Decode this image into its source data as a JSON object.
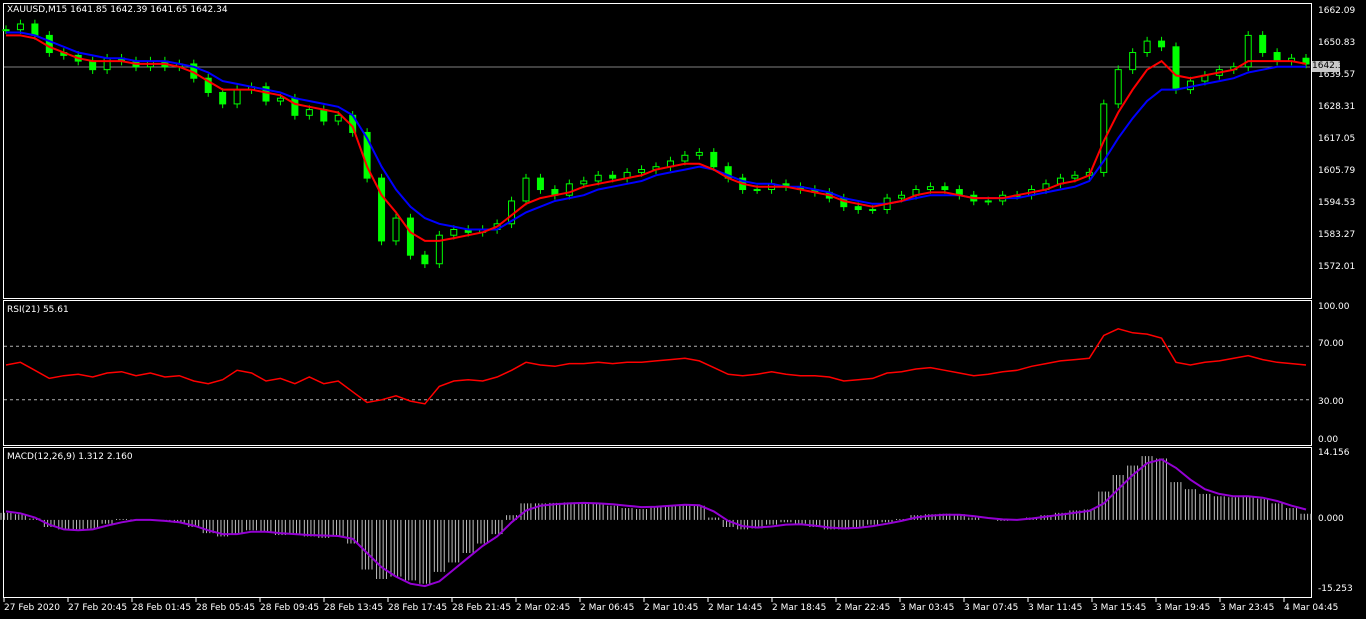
{
  "header": {
    "symbol": "XAUUSD,M15",
    "open": "1641.85",
    "high": "1642.39",
    "low": "1641.65",
    "close": "1642.34"
  },
  "current_price_label": "1642.34",
  "colors": {
    "background": "#000000",
    "frame": "#ffffff",
    "candle": "#00ff00",
    "ma_fast": "#ff0000",
    "ma_slow": "#0000ff",
    "rsi": "#ff0000",
    "macd_hist": "#c0c0c0",
    "macd_signal": "#9400d3"
  },
  "rsi": {
    "title": "RSI(21) 55.61",
    "levels": [
      70,
      30
    ],
    "ticks": [
      "100.00",
      "70.00",
      "30.00",
      "0.00"
    ]
  },
  "macd": {
    "title": "MACD(12,26,9) 1.312 2.160",
    "ticks": [
      "14.156",
      "0.000",
      "-15.253"
    ]
  },
  "chart_data": [
    {
      "type": "candlestick",
      "title": "XAUUSD,M15",
      "ylim": [
        1560,
        1663
      ],
      "yticks": [
        "1662.09",
        "1650.83",
        "1639.57",
        "1628.31",
        "1617.05",
        "1605.79",
        "1594.53",
        "1583.27",
        "1572.01"
      ],
      "x_labels": [
        "27 Feb 2020",
        "27 Feb 20:45",
        "28 Feb 01:45",
        "28 Feb 05:45",
        "28 Feb 09:45",
        "28 Feb 13:45",
        "28 Feb 17:45",
        "28 Feb 21:45",
        "2 Mar 02:45",
        "2 Mar 06:45",
        "2 Mar 10:45",
        "2 Mar 14:45",
        "2 Mar 18:45",
        "2 Mar 22:45",
        "3 Mar 03:45",
        "3 Mar 07:45",
        "3 Mar 11:45",
        "3 Mar 15:45",
        "3 Mar 19:45",
        "3 Mar 23:45",
        "4 Mar 04:45"
      ],
      "close_approx": [
        1654,
        1656,
        1652,
        1646,
        1645,
        1643,
        1640,
        1644,
        1643,
        1641,
        1643,
        1641,
        1642,
        1637,
        1632,
        1628,
        1633,
        1634,
        1629,
        1630,
        1624,
        1626,
        1622,
        1624,
        1618,
        1602,
        1580,
        1588,
        1575,
        1572,
        1582,
        1584,
        1583,
        1584,
        1586,
        1594,
        1602,
        1598,
        1596,
        1600,
        1601,
        1603,
        1602,
        1604,
        1605,
        1606,
        1608,
        1610,
        1611,
        1606,
        1602,
        1598,
        1598,
        1600,
        1599,
        1598,
        1597,
        1595,
        1592,
        1591,
        1591,
        1595,
        1596,
        1598,
        1599,
        1598,
        1596,
        1594,
        1594,
        1596,
        1596,
        1598,
        1600,
        1602,
        1603,
        1604,
        1628,
        1640,
        1646,
        1650,
        1648,
        1633,
        1636,
        1638,
        1640,
        1641,
        1652,
        1646,
        1643,
        1644,
        1642
      ],
      "series": [
        {
          "name": "MA fast",
          "color": "#ff0000",
          "values": [
            1652,
            1652,
            1651,
            1648,
            1646,
            1644,
            1643,
            1643,
            1643,
            1642,
            1642,
            1642,
            1641,
            1639,
            1636,
            1633,
            1633,
            1633,
            1632,
            1631,
            1628,
            1627,
            1626,
            1625,
            1620,
            1606,
            1596,
            1590,
            1583,
            1580,
            1580,
            1581,
            1582,
            1583,
            1585,
            1589,
            1593,
            1595,
            1596,
            1597,
            1599,
            1600,
            1601,
            1602,
            1603,
            1605,
            1606,
            1607,
            1607,
            1605,
            1602,
            1600,
            1599,
            1599,
            1599,
            1598,
            1597,
            1596,
            1594,
            1593,
            1592,
            1593,
            1594,
            1596,
            1597,
            1597,
            1596,
            1595,
            1595,
            1595,
            1596,
            1597,
            1598,
            1600,
            1601,
            1603,
            1615,
            1625,
            1633,
            1640,
            1643,
            1638,
            1637,
            1638,
            1639,
            1640,
            1643,
            1643,
            1643,
            1643,
            1642
          ]
        },
        {
          "name": "MA slow",
          "color": "#0000ff",
          "values": [
            1653,
            1653,
            1652,
            1650,
            1648,
            1646,
            1645,
            1644,
            1644,
            1643,
            1643,
            1643,
            1642,
            1641,
            1639,
            1636,
            1635,
            1634,
            1633,
            1632,
            1630,
            1629,
            1628,
            1627,
            1624,
            1616,
            1606,
            1598,
            1592,
            1588,
            1586,
            1585,
            1584,
            1584,
            1584,
            1587,
            1590,
            1592,
            1594,
            1595,
            1596,
            1598,
            1599,
            1600,
            1601,
            1603,
            1604,
            1605,
            1606,
            1605,
            1603,
            1601,
            1600,
            1600,
            1599,
            1599,
            1598,
            1597,
            1595,
            1594,
            1593,
            1593,
            1594,
            1595,
            1596,
            1596,
            1596,
            1595,
            1595,
            1595,
            1595,
            1596,
            1597,
            1598,
            1599,
            1601,
            1608,
            1616,
            1623,
            1629,
            1633,
            1633,
            1634,
            1635,
            1636,
            1637,
            1639,
            1640,
            1641,
            1641,
            1641
          ]
        }
      ]
    },
    {
      "type": "line",
      "title": "RSI(21) 55.61",
      "ylim": [
        0,
        100
      ],
      "series": [
        {
          "name": "RSI(21)",
          "color": "#ff0000",
          "values": [
            56,
            58,
            52,
            46,
            48,
            49,
            47,
            50,
            51,
            48,
            50,
            47,
            48,
            44,
            42,
            45,
            52,
            50,
            44,
            46,
            42,
            47,
            42,
            44,
            36,
            28,
            30,
            33,
            29,
            27,
            40,
            44,
            45,
            44,
            47,
            52,
            58,
            56,
            55,
            57,
            57,
            58,
            57,
            58,
            58,
            59,
            60,
            61,
            59,
            54,
            49,
            48,
            49,
            51,
            49,
            48,
            48,
            47,
            44,
            45,
            46,
            50,
            51,
            53,
            54,
            52,
            50,
            48,
            49,
            51,
            52,
            55,
            57,
            59,
            60,
            61,
            78,
            83,
            80,
            79,
            76,
            58,
            56,
            58,
            59,
            61,
            63,
            60,
            58,
            57,
            56
          ]
        }
      ]
    },
    {
      "type": "bar",
      "title": "MACD(12,26,9) 1.312 2.160",
      "ylim": [
        -15.253,
        14.156
      ],
      "series": [
        {
          "name": "MACD histogram",
          "color": "#c0c0c0",
          "values": [
            1.5,
            1.2,
            0.3,
            -1.5,
            -2.0,
            -2.0,
            -1.8,
            -0.8,
            0.2,
            0.1,
            0.0,
            -0.3,
            -0.6,
            -1.5,
            -2.8,
            -3.5,
            -3.0,
            -2.2,
            -2.5,
            -3.2,
            -3.0,
            -3.5,
            -3.8,
            -3.5,
            -5.0,
            -10.5,
            -12.5,
            -12.0,
            -12.8,
            -13.5,
            -11.0,
            -9.0,
            -7.0,
            -5.0,
            -3.0,
            1.0,
            3.5,
            3.5,
            3.6,
            3.7,
            3.6,
            3.5,
            3.0,
            2.5,
            2.3,
            2.8,
            3.0,
            3.2,
            3.0,
            0.5,
            -1.5,
            -2.0,
            -1.8,
            -1.0,
            -0.5,
            -0.8,
            -1.5,
            -2.0,
            -2.0,
            -1.5,
            -1.0,
            -0.5,
            0.2,
            1.0,
            1.2,
            1.3,
            1.2,
            0.5,
            0.0,
            -0.2,
            0.0,
            0.5,
            1.0,
            1.5,
            2.0,
            2.2,
            6.0,
            9.5,
            11.5,
            13.5,
            13.0,
            8.0,
            6.5,
            5.5,
            5.0,
            4.8,
            5.0,
            4.5,
            3.5,
            2.5,
            1.3
          ]
        },
        {
          "name": "Signal",
          "color": "#9400d3",
          "values": [
            1.8,
            1.4,
            0.5,
            -1.0,
            -2.0,
            -2.2,
            -2.0,
            -1.2,
            -0.5,
            0.0,
            0.0,
            -0.2,
            -0.5,
            -1.2,
            -2.2,
            -3.0,
            -3.0,
            -2.5,
            -2.5,
            -2.8,
            -3.0,
            -3.2,
            -3.3,
            -3.4,
            -4.0,
            -7.0,
            -10.0,
            -12.0,
            -13.5,
            -14.0,
            -13.0,
            -10.5,
            -8.0,
            -5.5,
            -3.5,
            -0.5,
            2.0,
            3.0,
            3.3,
            3.5,
            3.6,
            3.5,
            3.3,
            3.0,
            2.7,
            2.8,
            3.0,
            3.2,
            3.1,
            1.8,
            -0.2,
            -1.3,
            -1.6,
            -1.4,
            -1.0,
            -0.9,
            -1.2,
            -1.6,
            -1.8,
            -1.7,
            -1.3,
            -0.8,
            -0.2,
            0.5,
            0.9,
            1.1,
            1.1,
            0.8,
            0.4,
            0.1,
            0.0,
            0.3,
            0.7,
            1.1,
            1.5,
            1.9,
            3.5,
            6.5,
            9.5,
            12.0,
            12.8,
            11.0,
            8.5,
            6.5,
            5.5,
            5.0,
            5.0,
            4.7,
            4.0,
            3.0,
            2.2
          ]
        }
      ]
    }
  ]
}
